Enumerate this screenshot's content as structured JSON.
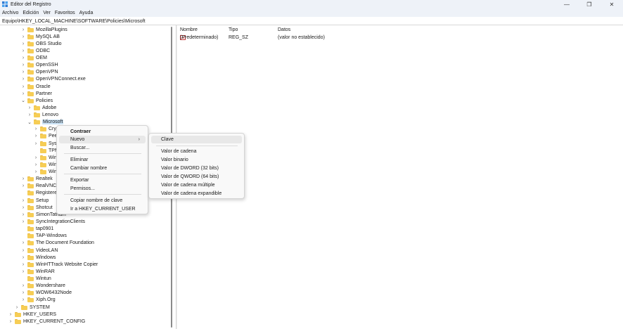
{
  "window": {
    "title": "Editor del Registro",
    "minimize_glyph": "—",
    "maximize_glyph": "❐",
    "close_glyph": "✕"
  },
  "menubar": [
    "Archivo",
    "Edición",
    "Ver",
    "Favoritos",
    "Ayuda"
  ],
  "address": "Equipo\\HKEY_LOCAL_MACHINE\\SOFTWARE\\Policies\\Microsoft",
  "tree": [
    {
      "label": "MozillaPlugins",
      "chev": "›"
    },
    {
      "label": "MySQL AB",
      "chev": "›"
    },
    {
      "label": "OBS Studio",
      "chev": "›"
    },
    {
      "label": "ODBC",
      "chev": "›"
    },
    {
      "label": "OEM",
      "chev": "›"
    },
    {
      "label": "OpenSSH",
      "chev": "›"
    },
    {
      "label": "OpenVPN",
      "chev": "›"
    },
    {
      "label": "OpenVPNConnect.exe",
      "chev": "›"
    },
    {
      "label": "Oracle",
      "chev": "›"
    },
    {
      "label": "Partner",
      "chev": "›"
    },
    {
      "label": "Policies",
      "chev": "⌄"
    },
    {
      "label": "Adobe",
      "chev": "›"
    },
    {
      "label": "Lenovo",
      "chev": "›"
    },
    {
      "label": "Microsoft",
      "chev": "⌄"
    },
    {
      "label": "Cryp",
      "chev": "›"
    },
    {
      "label": "Pee",
      "chev": "›"
    },
    {
      "label": "Syst",
      "chev": "›"
    },
    {
      "label": "TPM",
      "chev": ""
    },
    {
      "label": "Win",
      "chev": "›"
    },
    {
      "label": "Win",
      "chev": "›"
    },
    {
      "label": "Win",
      "chev": "›"
    },
    {
      "label": "Realtek",
      "chev": "›"
    },
    {
      "label": "RealVNC",
      "chev": "›"
    },
    {
      "label": "Registered",
      "chev": ""
    },
    {
      "label": "Setup",
      "chev": "›"
    },
    {
      "label": "Shotcut",
      "chev": "›"
    },
    {
      "label": "SimonTatham",
      "chev": "›"
    },
    {
      "label": "SyncIntegrationClients",
      "chev": "›"
    },
    {
      "label": "tap0901",
      "chev": ""
    },
    {
      "label": "TAP-Windows",
      "chev": ""
    },
    {
      "label": "The Document Foundation",
      "chev": "›"
    },
    {
      "label": "VideoLAN",
      "chev": "›"
    },
    {
      "label": "Windows",
      "chev": "›"
    },
    {
      "label": "WinHTTrack Website Copier",
      "chev": "›"
    },
    {
      "label": "WinRAR",
      "chev": "›"
    },
    {
      "label": "Wintun",
      "chev": ""
    },
    {
      "label": "Wondershare",
      "chev": "›"
    },
    {
      "label": "WOW6432Node",
      "chev": "›"
    },
    {
      "label": "Xiph.Org",
      "chev": "›"
    },
    {
      "label": "SYSTEM",
      "chev": "›"
    },
    {
      "label": "HKEY_USERS",
      "chev": "›"
    },
    {
      "label": "HKEY_CURRENT_CONFIG",
      "chev": "›"
    }
  ],
  "list": {
    "columns": [
      "Nombre",
      "Tipo",
      "Datos"
    ],
    "rows": [
      {
        "icon": "ab",
        "name": "(Predeterminado)",
        "type": "REG_SZ",
        "data": "(valor no establecido)"
      }
    ]
  },
  "context_menu": {
    "items": [
      "Contraer",
      "Nuevo",
      "Buscar...",
      "Eliminar",
      "Cambiar nombre",
      "Exportar",
      "Permisos...",
      "Copiar nombre de clave",
      "Ir a HKEY_CURRENT_USER"
    ],
    "arrow": "›"
  },
  "submenu": {
    "items": [
      "Clave",
      "Valor de cadena",
      "Valor binario",
      "Valor de DWORD (32 bits)",
      "Valor de QWORD (64 bits)",
      "Valor de cadena múltiple",
      "Valor de cadena expandible"
    ]
  }
}
